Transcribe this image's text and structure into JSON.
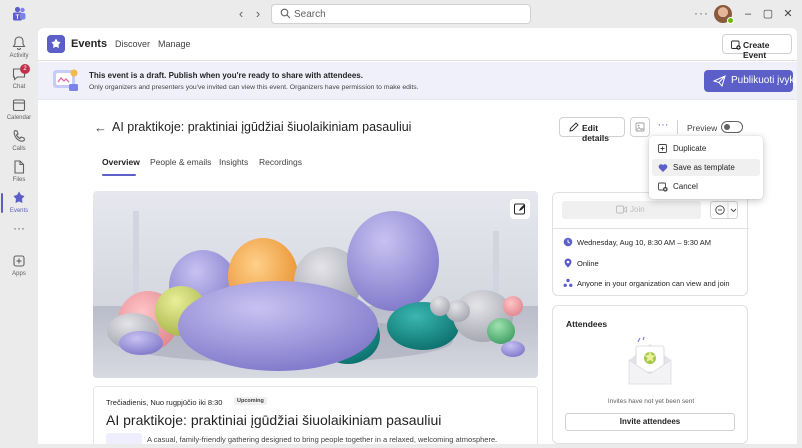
{
  "titlebar": {
    "search_placeholder": "Search"
  },
  "rail": {
    "items": [
      {
        "label": "Activity",
        "icon": "bell-icon"
      },
      {
        "label": "Chat",
        "icon": "chat-icon",
        "badge": "2"
      },
      {
        "label": "Calendar",
        "icon": "calendar-icon"
      },
      {
        "label": "Calls",
        "icon": "phone-icon"
      },
      {
        "label": "Files",
        "icon": "file-icon"
      },
      {
        "label": "Events",
        "icon": "events-icon",
        "active": true
      },
      {
        "label": "",
        "icon": "more-icon"
      },
      {
        "label": "Apps",
        "icon": "apps-icon"
      }
    ]
  },
  "appbar": {
    "title": "Events",
    "tabs": [
      "Discover",
      "Manage"
    ],
    "create_label": "Create Event"
  },
  "banner": {
    "title": "This event is a draft. Publish when you're ready to share with attendees.",
    "subtitle": "Only organizers and presenters you've invited can view this event. Organizers have permission to make edits.",
    "publish_label": "Publikuoti įvykį"
  },
  "event": {
    "title": "AI praktikoje: praktiniai įgūdžiai šiuolaikiniam pasauliui",
    "edit_label": "Edit details",
    "preview_label": "Preview",
    "tabs": [
      "Overview",
      "People & emails",
      "Insights",
      "Recordings"
    ]
  },
  "info": {
    "date": "Trečiadienis, Nuo rugpjūčio iki 8:30",
    "status": "Upcoming",
    "title": "AI praktikoje: praktiniai įgūdžiai šiuolaikiniam pasauliui",
    "description": "A casual, family-friendly gathering designed to bring people together in a relaxed, welcoming atmosphere."
  },
  "side": {
    "join_label": "Join",
    "datetime": "Wednesday, Aug 10, 8:30 AM – 9:30 AM",
    "location": "Online",
    "access": "Anyone in your organization can view and join"
  },
  "attendees": {
    "title": "Attendees",
    "note": "Invites have not yet been sent",
    "invite_label": "Invite attendees"
  },
  "menu": {
    "items": [
      "Duplicate",
      "Save as template",
      "Cancel"
    ]
  },
  "colors": {
    "accent": "#5b5fc7",
    "badge": "#c4314b"
  }
}
